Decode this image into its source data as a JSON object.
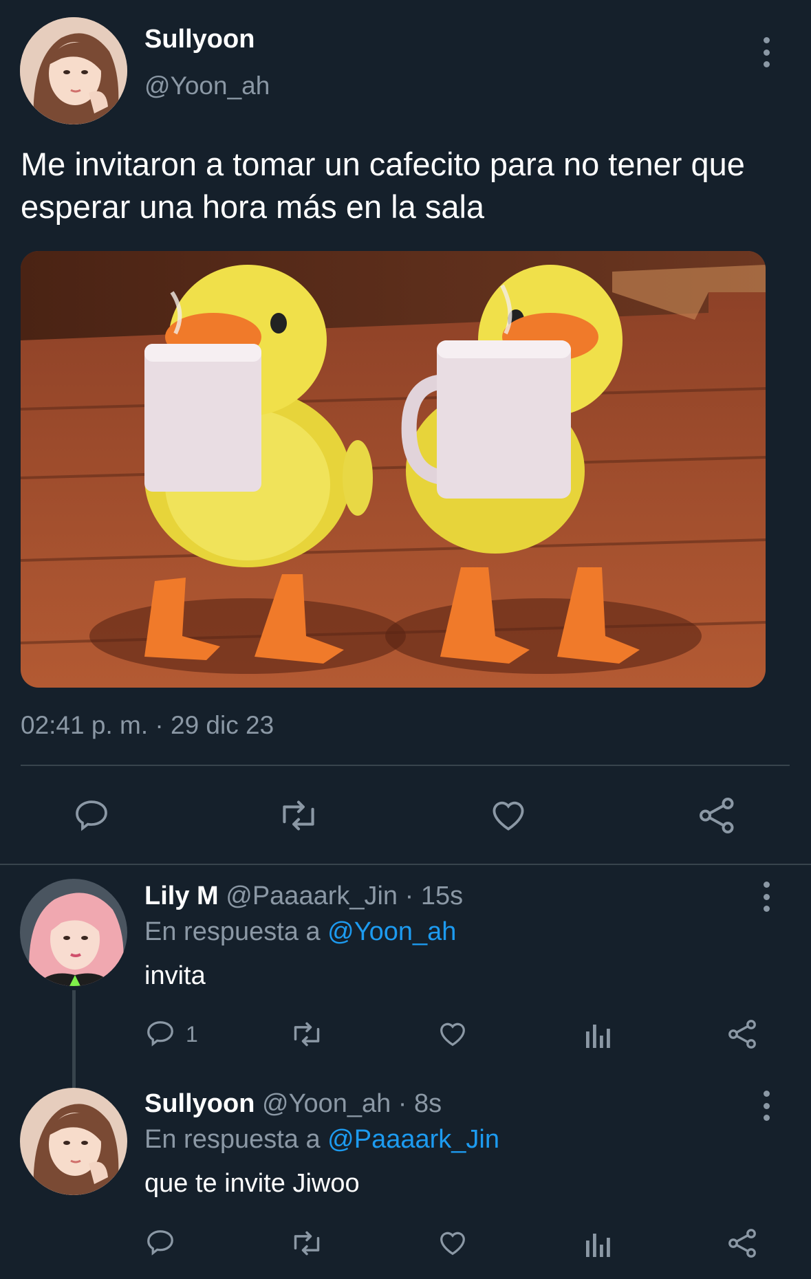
{
  "main_tweet": {
    "display_name": "Sullyoon",
    "handle": "@Yoon_ah",
    "text": "Me invitaron a tomar un cafecito para no tener que esperar una hora más en la sala",
    "timestamp": "02:41 p. m. · 29 dic 23",
    "actions": [
      "reply-icon",
      "retweet-icon",
      "like-icon",
      "share-icon"
    ]
  },
  "replies": [
    {
      "display_name": "Lily M",
      "handle_time": "@Paaaark_Jin · 15s",
      "replying_prefix": "En respuesta a",
      "replying_to": "@Yoon_ah",
      "text": "invita",
      "reply_count": "1"
    },
    {
      "display_name": "Sullyoon",
      "handle_time": "@Yoon_ah · 8s",
      "replying_prefix": "En respuesta a",
      "replying_to": "@Paaaark_Jin",
      "text": "que te invite Jiwoo",
      "reply_count": ""
    }
  ],
  "colors": {
    "background": "#15202b",
    "muted": "#8b98a5",
    "link": "#1d9bf0",
    "divider": "#38444d"
  }
}
